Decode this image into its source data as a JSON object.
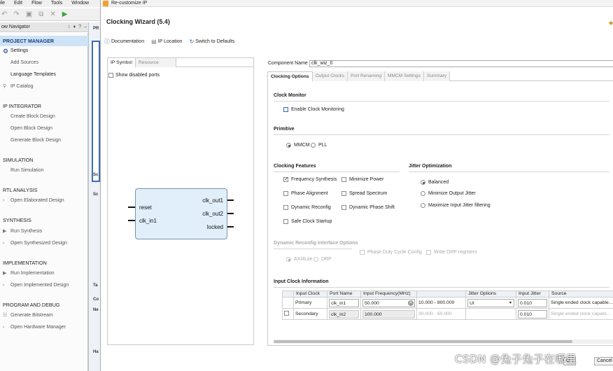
{
  "ide": {
    "menu": [
      "ile",
      "Edit",
      "Flow",
      "Tools",
      "Window"
    ],
    "flow_nav_title": "ow Navigator",
    "header_icons": [
      "↕",
      "♦",
      "?",
      "‒"
    ],
    "mid_tabs": [
      "PR",
      "Sc",
      "Sc",
      "Ta",
      "Co",
      "Ne",
      "Ha"
    ],
    "sections": [
      {
        "label": "PROJECT MANAGER",
        "items": [
          {
            "label": "Settings",
            "icon": "gear-icon"
          },
          {
            "label": "Add Sources"
          },
          {
            "label": "Language Templates"
          },
          {
            "label": "IP Catalog",
            "icon": "ip-pin-icon"
          }
        ]
      },
      {
        "label": "IP INTEGRATOR",
        "items": [
          {
            "label": "Create Block Design"
          },
          {
            "label": "Open Block Design"
          },
          {
            "label": "Generate Block Design"
          }
        ]
      },
      {
        "label": "SIMULATION",
        "items": [
          {
            "label": "Run Simulation"
          }
        ]
      },
      {
        "label": "RTL ANALYSIS",
        "items": [
          {
            "label": "Open Elaborated Design",
            "expand": true
          }
        ]
      },
      {
        "label": "SYNTHESIS",
        "items": [
          {
            "label": "Run Synthesis",
            "icon": "play-icon"
          },
          {
            "label": "Open Synthesized Design",
            "expand": true
          }
        ]
      },
      {
        "label": "IMPLEMENTATION",
        "items": [
          {
            "label": "Run Implementation",
            "icon": "play-icon"
          },
          {
            "label": "Open Implemented Design",
            "expand": true
          }
        ]
      },
      {
        "label": "PROGRAM AND DEBUG",
        "items": [
          {
            "label": "Generate Bitstream",
            "icon": "bitstream-icon"
          },
          {
            "label": "Open Hardware Manager",
            "expand": true
          }
        ]
      }
    ]
  },
  "dialog": {
    "title": "Re-customize IP",
    "wizard_title": "Clocking Wizard (5.4)",
    "links": {
      "documentation": "Documentation",
      "ip_location": "IP Location",
      "switch_defaults": "Switch to Defaults"
    },
    "left_tabs": {
      "ip_symbol": "IP Symbol",
      "resource": "Resource"
    },
    "show_disabled_ports": "Show disabled ports",
    "symbol": {
      "inputs": [
        "reset",
        "clk_in1"
      ],
      "outputs": [
        "clk_out1",
        "clk_out2",
        "locked"
      ]
    },
    "component_name_label": "Component Name",
    "component_name": "clk_wiz_0",
    "tabs": [
      "Clocking Options",
      "Output Clocks",
      "Port Renaming",
      "MMCM Settings",
      "Summary"
    ],
    "clock_monitor": {
      "title": "Clock Monitor",
      "enable": "Enable Clock Monitoring"
    },
    "primitive": {
      "title": "Primitive",
      "mmcm": "MMCM",
      "pll": "PLL",
      "selected": "MMCM"
    },
    "features": {
      "title": "Clocking Features",
      "frequency_synthesis": "Frequency Synthesis",
      "minimize_power": "Minimize Power",
      "phase_alignment": "Phase Alignment",
      "spread_spectrum": "Spread Spectrum",
      "dynamic_reconfig": "Dynamic Reconfig",
      "dynamic_phase_shift": "Dynamic Phase Shift",
      "safe_clock_startup": "Safe Clock Startup"
    },
    "jitter": {
      "title": "Jitter Optimization",
      "balanced": "Balanced",
      "min_output": "Minimize Output Jitter",
      "max_input": "Maximize Input Jitter filtering",
      "selected": "Balanced"
    },
    "drp": {
      "title": "Dynamic Reconfig Interface Options",
      "phase_duty": "Phase Duty Cycle Config",
      "write_drp": "Write DRP registers",
      "axi4lite": "AXI4Lite",
      "drp": "DRP"
    },
    "input_clock": {
      "title": "Input Clock Information",
      "headers": [
        "Input Clock",
        "Port Name",
        "Input Frequency(MHz)",
        "",
        "Jitter Options",
        "Input Jitter",
        "Source"
      ],
      "rows": [
        {
          "clock": "Primary",
          "port": "clk_in1",
          "freq": "50.000",
          "range": "10.000 - 800.000",
          "jitter_opt": "UI",
          "jitter": "0.010",
          "source": "Single ended clock capable..."
        },
        {
          "clock": "Secondary",
          "port": "clk_in2",
          "freq": "100.000",
          "range": "30.000 - 60.000",
          "jitter_opt": "",
          "jitter": "0.010",
          "source": "Single ended clock capabl..."
        }
      ]
    },
    "buttons": {
      "ok": "OK",
      "cancel": "Cancel"
    },
    "watermark": "CSDN @兔子兔子在哪里"
  }
}
